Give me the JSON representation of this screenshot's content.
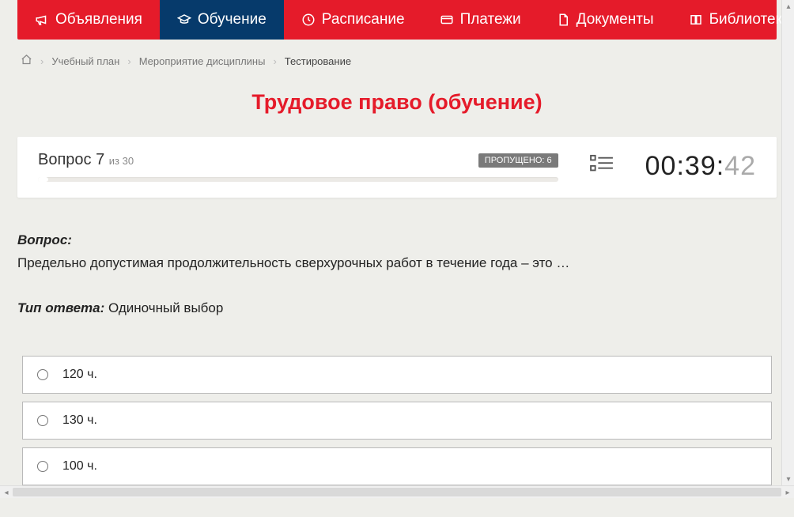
{
  "nav": {
    "items": [
      {
        "icon": "megaphone",
        "label": "Объявления",
        "active": false
      },
      {
        "icon": "graduation",
        "label": "Обучение",
        "active": true
      },
      {
        "icon": "clock",
        "label": "Расписание",
        "active": false
      },
      {
        "icon": "card",
        "label": "Платежи",
        "active": false
      },
      {
        "icon": "doc",
        "label": "Документы",
        "active": false
      },
      {
        "icon": "book",
        "label": "Библиотека",
        "active": false,
        "dropdown": true
      }
    ]
  },
  "breadcrumb": {
    "items": [
      {
        "label": "Учебный план"
      },
      {
        "label": "Мероприятие дисциплины"
      }
    ],
    "current": "Тестирование"
  },
  "title": "Трудовое право (обучение)",
  "question_header": {
    "question_word": "Вопрос",
    "number": "7",
    "of_word": "из",
    "total": "30",
    "skipped_label": "ПРОПУЩЕНО: 6",
    "timer_main": "00:39:",
    "timer_ms": "42"
  },
  "question": {
    "label": "Вопрос:",
    "text": "Предельно допустимая продолжительность сверхурочных работ в течение года – это …",
    "answer_type_label": "Тип ответа:",
    "answer_type_value": "Одиночный выбор",
    "options": [
      {
        "text": "120 ч."
      },
      {
        "text": "130 ч."
      },
      {
        "text": "100 ч."
      }
    ]
  }
}
